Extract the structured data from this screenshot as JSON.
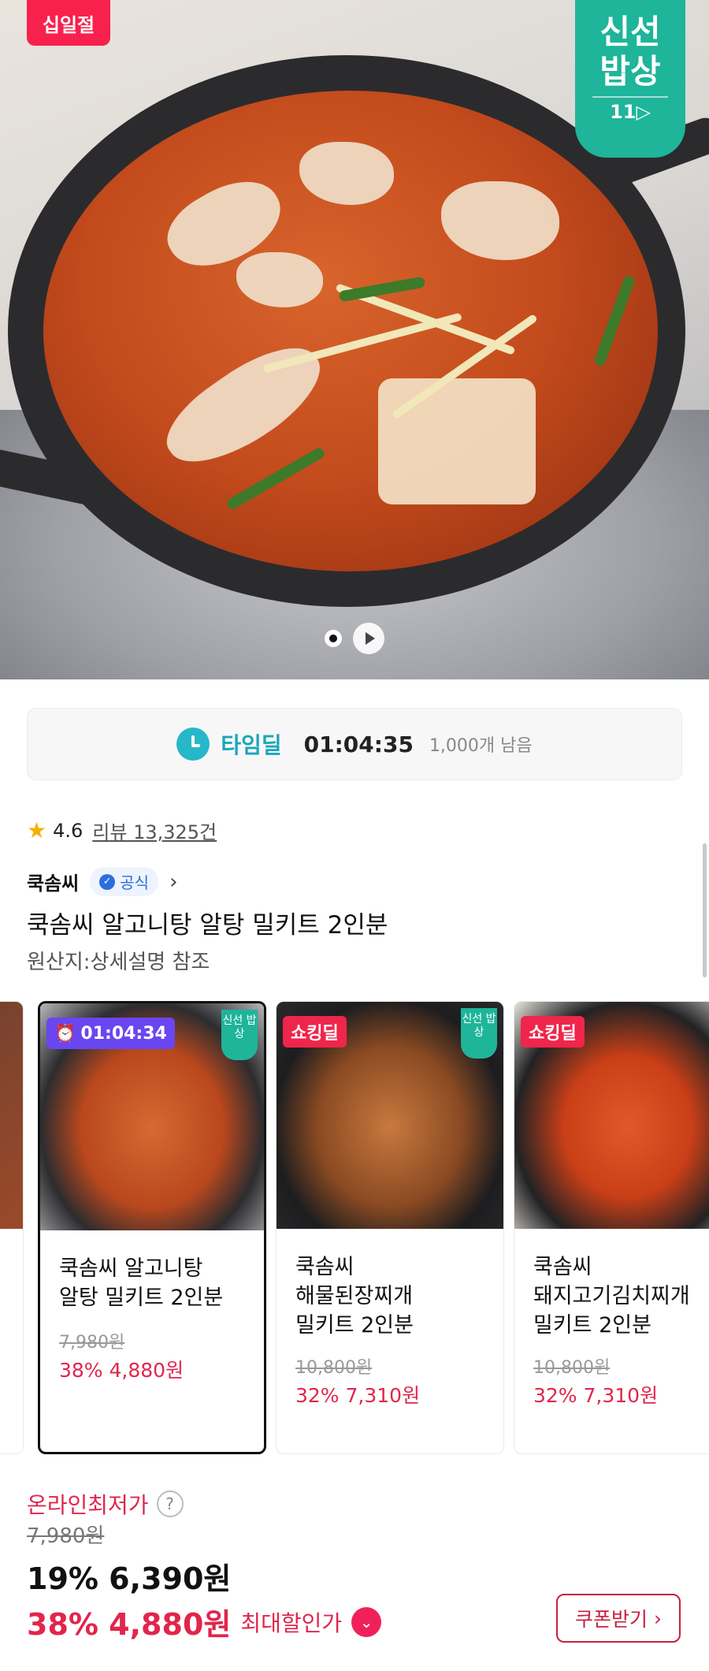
{
  "hero": {
    "sale_badge": "십일절",
    "fresh_badge": {
      "line1": "신선",
      "line2": "밥상",
      "line3": "11▷"
    }
  },
  "timedeal": {
    "label": "타임딜",
    "countdown": "01:04:35",
    "remaining": "1,000개 남음",
    "clock_icon": "alarm-clock-icon"
  },
  "product": {
    "rating": "4.6",
    "review_count": "리뷰 13,325건",
    "seller": "쿡솜씨",
    "official_label": "공식",
    "title": "쿡솜씨 알고니탕 알탕 밀키트 2인분",
    "origin": "원산지:상세설명 참조"
  },
  "related": [
    {
      "tag": "01:04:34",
      "tag_type": "time",
      "badge": "신선\n밥상",
      "name": "쿡솜씨 알고니탕\n알탕 밀키트 2인분",
      "original_price": "7,980원",
      "price": "38% 4,880원",
      "selected": true
    },
    {
      "tag": "쇼킹딜",
      "tag_type": "shock",
      "badge": "신선\n밥상",
      "name": "쿡솜씨\n해물된장찌개\n밀키트 2인분",
      "original_price": "10,800원",
      "price": "32% 7,310원",
      "selected": false
    },
    {
      "tag": "쇼킹딜",
      "tag_type": "shock",
      "badge": "",
      "name": "쿡솜씨\n돼지고기김치찌개\n밀키트 2인분",
      "original_price": "10,800원",
      "price": "32% 7,310원",
      "selected": false
    }
  ],
  "pricing": {
    "lowest_label": "온라인최저가",
    "original": "7,980원",
    "sale": "19% 6,390원",
    "max_discount": "38% 4,880원",
    "max_label": "최대할인가",
    "coupon_button": "쿠폰받기"
  },
  "colors": {
    "accent": "#e2254c",
    "fresh": "#1eb59a",
    "timedeal": "#1aa6b9",
    "sale_badge": "#f8204d"
  }
}
